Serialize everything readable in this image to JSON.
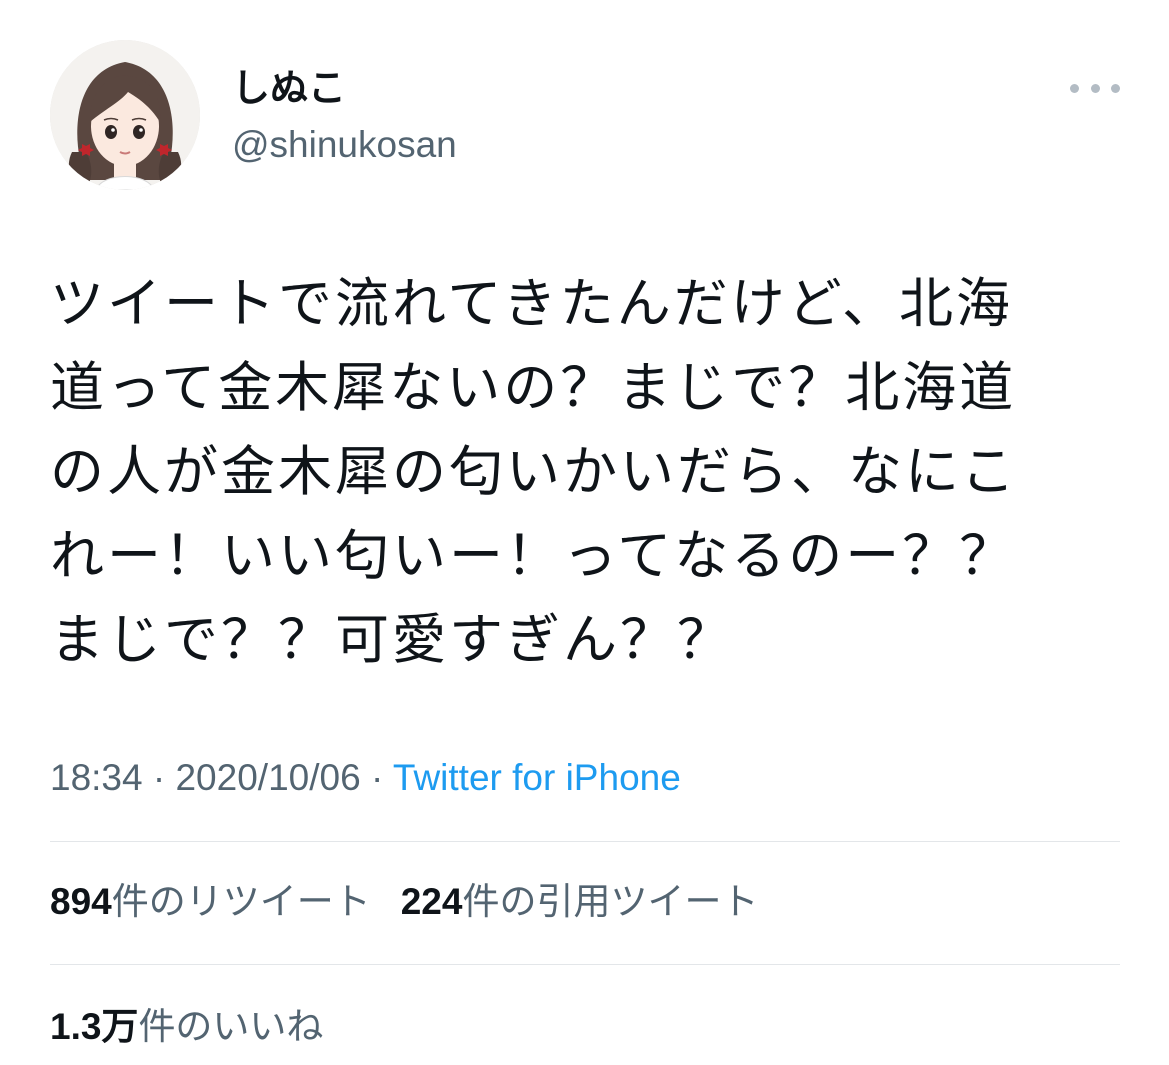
{
  "author": {
    "display_name": "しぬこ",
    "handle": "@shinukosan"
  },
  "tweet": {
    "text": "ツイートで流れてきたんだけど、北海\n道って金木犀ないの？まじで？北海道\nの人が金木犀の匂いかいだら、なにこ\nれー！いい匂いー！ってなるのー？？\nまじで？？可愛すぎん？？",
    "time": "18:34",
    "date": "2020/10/06",
    "separator": " · ",
    "source": "Twitter for iPhone"
  },
  "stats": {
    "retweets": {
      "count": "894",
      "label": "件のリツイート"
    },
    "quotes": {
      "count": "224",
      "label": "件の引用ツイート"
    },
    "likes": {
      "count": "1.3万",
      "label": "件のいいね"
    }
  },
  "icons": {
    "more": "more-horizontal-icon",
    "avatar": "avatar-illustration"
  }
}
